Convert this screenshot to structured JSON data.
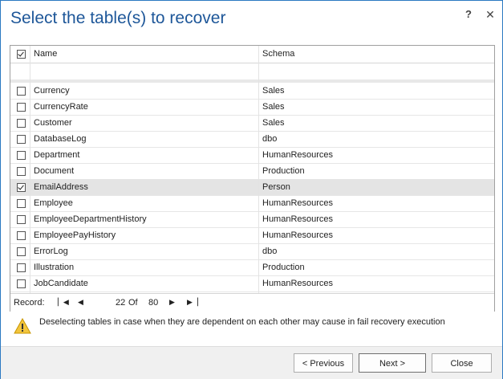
{
  "title": "Select the table(s) to recover",
  "header": {
    "name": "Name",
    "schema": "Schema",
    "all_checked": true
  },
  "rows": [
    {
      "name": "Currency",
      "schema": "Sales",
      "checked": false
    },
    {
      "name": "CurrencyRate",
      "schema": "Sales",
      "checked": false
    },
    {
      "name": "Customer",
      "schema": "Sales",
      "checked": false
    },
    {
      "name": "DatabaseLog",
      "schema": "dbo",
      "checked": false
    },
    {
      "name": "Department",
      "schema": "HumanResources",
      "checked": false
    },
    {
      "name": "Document",
      "schema": "Production",
      "checked": false
    },
    {
      "name": "EmailAddress",
      "schema": "Person",
      "checked": true,
      "selected": true
    },
    {
      "name": "Employee",
      "schema": "HumanResources",
      "checked": false
    },
    {
      "name": "EmployeeDepartmentHistory",
      "schema": "HumanResources",
      "checked": false
    },
    {
      "name": "EmployeePayHistory",
      "schema": "HumanResources",
      "checked": false
    },
    {
      "name": "ErrorLog",
      "schema": "dbo",
      "checked": false
    },
    {
      "name": "Illustration",
      "schema": "Production",
      "checked": false
    },
    {
      "name": "JobCandidate",
      "schema": "HumanResources",
      "checked": false
    }
  ],
  "pager": {
    "label": "Record:",
    "current": "22",
    "of_label": "Of",
    "total": "80"
  },
  "warning": {
    "icon": "warning-icon",
    "text": "Deselecting tables in case when they are dependent on each other may cause in fail recovery execution"
  },
  "buttons": {
    "previous": "< Previous",
    "next": "Next >",
    "close": "Close"
  }
}
